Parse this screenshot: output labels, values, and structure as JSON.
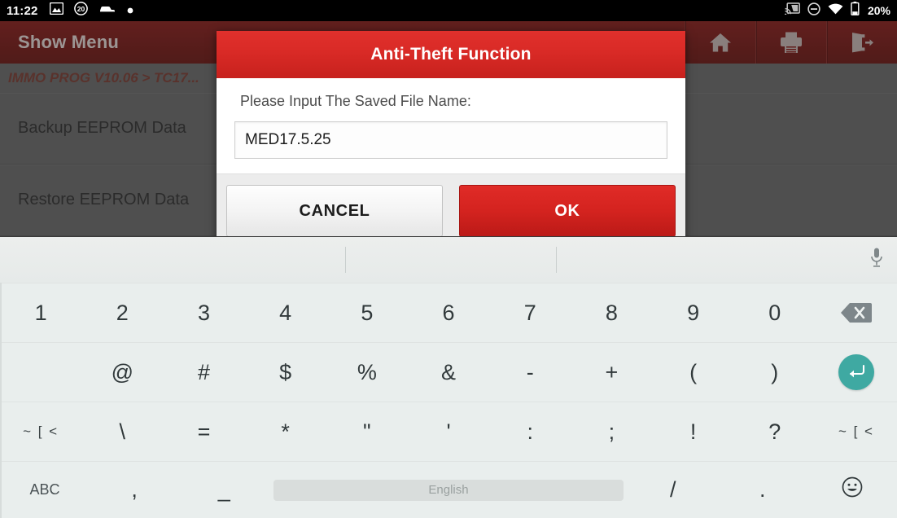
{
  "status_bar": {
    "clock": "11:22",
    "battery_percent": "20%",
    "left_icons": [
      "photo-icon",
      "notification-count-20-icon",
      "vehicle-icon",
      "dot-icon"
    ],
    "right_icons": [
      "cast-icon",
      "do-not-disturb-icon",
      "wifi-icon",
      "battery-icon"
    ],
    "notification_badge": "20"
  },
  "app_bar": {
    "title": "Show Menu",
    "buttons": [
      {
        "name": "home-button",
        "icon": "home-icon"
      },
      {
        "name": "print-button",
        "icon": "printer-icon"
      },
      {
        "name": "exit-button",
        "icon": "exit-icon"
      }
    ]
  },
  "breadcrumb": "IMMO PROG V10.06 > TC17...",
  "menu_list": [
    {
      "label": "Backup EEPROM Data"
    },
    {
      "label": "Restore EEPROM Data"
    }
  ],
  "dialog": {
    "title": "Anti-Theft Function",
    "prompt": "Please Input The Saved File Name:",
    "input_value": "MED17.5.25",
    "input_placeholder": "",
    "cancel_label": "CANCEL",
    "ok_label": "OK",
    "title_bar_color": "#d92a26",
    "ok_color": "#d4231f"
  },
  "keyboard": {
    "suggestion_text": "",
    "mic_icon": "microphone-icon",
    "enter_color": "#3fa9a2",
    "space_label": "English",
    "rows": [
      {
        "name": "row-numbers",
        "keys": [
          {
            "label": "1",
            "name": "key-1",
            "type": "char"
          },
          {
            "label": "2",
            "name": "key-2",
            "type": "char"
          },
          {
            "label": "3",
            "name": "key-3",
            "type": "char"
          },
          {
            "label": "4",
            "name": "key-4",
            "type": "char"
          },
          {
            "label": "5",
            "name": "key-5",
            "type": "char"
          },
          {
            "label": "6",
            "name": "key-6",
            "type": "char"
          },
          {
            "label": "7",
            "name": "key-7",
            "type": "char"
          },
          {
            "label": "8",
            "name": "key-8",
            "type": "char"
          },
          {
            "label": "9",
            "name": "key-9",
            "type": "char"
          },
          {
            "label": "0",
            "name": "key-0",
            "type": "char"
          },
          {
            "label": "",
            "name": "key-backspace",
            "type": "backspace"
          }
        ]
      },
      {
        "name": "row-symbols-1",
        "keys": [
          {
            "label": "",
            "name": "key-blank-left",
            "type": "blank"
          },
          {
            "label": "@",
            "name": "key-at",
            "type": "char"
          },
          {
            "label": "#",
            "name": "key-hash",
            "type": "char"
          },
          {
            "label": "$",
            "name": "key-dollar",
            "type": "char"
          },
          {
            "label": "%",
            "name": "key-percent",
            "type": "char"
          },
          {
            "label": "&",
            "name": "key-ampersand",
            "type": "char"
          },
          {
            "label": "-",
            "name": "key-hyphen",
            "type": "char"
          },
          {
            "label": "+",
            "name": "key-plus",
            "type": "char"
          },
          {
            "label": "(",
            "name": "key-paren-open",
            "type": "char"
          },
          {
            "label": ")",
            "name": "key-paren-close",
            "type": "char"
          },
          {
            "label": "",
            "name": "key-enter",
            "type": "enter"
          }
        ]
      },
      {
        "name": "row-symbols-2",
        "keys": [
          {
            "label": "~ [ <",
            "name": "key-symbol-shift-left",
            "type": "sym"
          },
          {
            "label": "\\",
            "name": "key-backslash",
            "type": "char"
          },
          {
            "label": "=",
            "name": "key-equals",
            "type": "char"
          },
          {
            "label": "*",
            "name": "key-asterisk",
            "type": "char"
          },
          {
            "label": "\"",
            "name": "key-double-quote",
            "type": "char"
          },
          {
            "label": "'",
            "name": "key-single-quote",
            "type": "char"
          },
          {
            "label": ":",
            "name": "key-colon",
            "type": "char"
          },
          {
            "label": ";",
            "name": "key-semicolon",
            "type": "char"
          },
          {
            "label": "!",
            "name": "key-exclamation",
            "type": "char"
          },
          {
            "label": "?",
            "name": "key-question",
            "type": "char"
          },
          {
            "label": "~ [ <",
            "name": "key-symbol-shift-right",
            "type": "sym"
          }
        ]
      },
      {
        "name": "row-bottom",
        "keys": [
          {
            "label": "ABC",
            "name": "key-abc-mode",
            "type": "small"
          },
          {
            "label": ",",
            "name": "key-comma",
            "type": "char"
          },
          {
            "label": "_",
            "name": "key-underscore",
            "type": "char"
          },
          {
            "label": "English",
            "name": "key-space",
            "type": "space"
          },
          {
            "label": "/",
            "name": "key-slash",
            "type": "char"
          },
          {
            "label": ".",
            "name": "key-period",
            "type": "char"
          },
          {
            "label": "",
            "name": "key-emoji",
            "type": "emoji"
          }
        ]
      }
    ]
  }
}
